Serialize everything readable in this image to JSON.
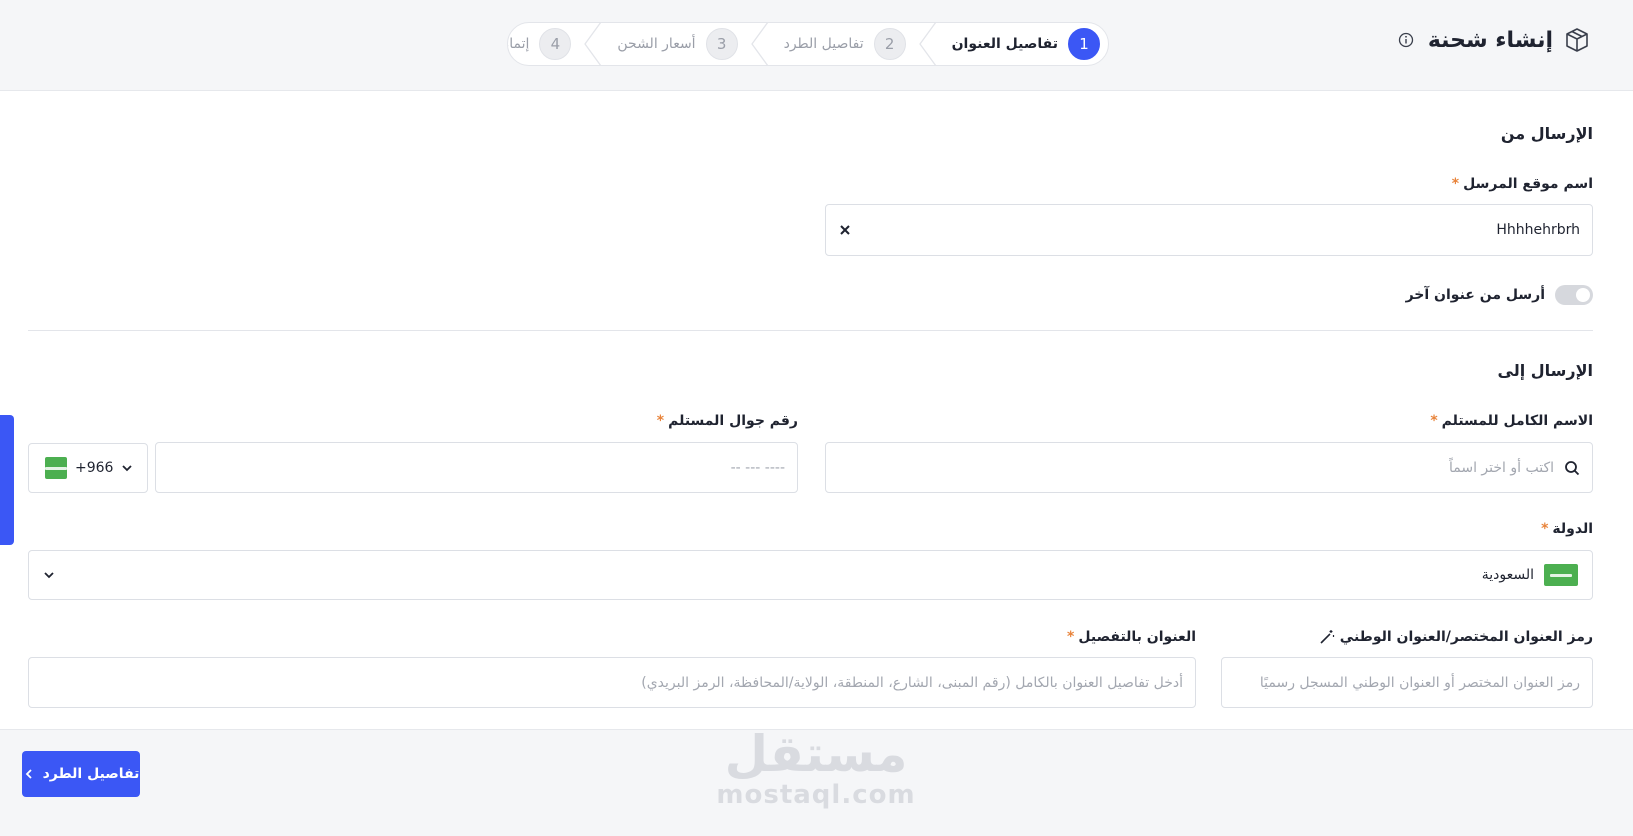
{
  "header": {
    "title": "إنشاء شحنة"
  },
  "stepper": {
    "steps": [
      {
        "number": "1",
        "label": "تفاصيل العنوان"
      },
      {
        "number": "2",
        "label": "تفاصيل الطرد"
      },
      {
        "number": "3",
        "label": "أسعار الشحن"
      },
      {
        "number": "4",
        "label": "إتمام الطلب"
      }
    ]
  },
  "sender": {
    "section_title": "الإرسال من",
    "location_label": "اسم موقع المرسل",
    "location_value": "Hhhhehrbrh",
    "toggle_label": "أرسل من عنوان آخر"
  },
  "recipient": {
    "section_title": "الإرسال إلى",
    "full_name_label": "الاسم الكامل للمستلم",
    "full_name_placeholder": "اكتب  أو اختر اسماً",
    "phone_label": "رقم جوال المستلم",
    "phone_placeholder": "---- --- --",
    "phone_code": "+966",
    "country_label": "الدولة",
    "country_value": "السعودية",
    "short_address_label": "رمز العنوان المختصر/العنوان الوطني",
    "short_address_placeholder": "رمز العنوان المختصر أو العنوان الوطني المسجل رسميًا",
    "detailed_address_label": "العنوان بالتفصيل",
    "detailed_address_placeholder": "أدخل تفاصيل العنوان بالكامل (رقم المبنى، الشارع، المنطقة، الولاية/المحافظة، الرمز البريدي)",
    "required_mark": "*"
  },
  "footer": {
    "next_button_label": "تفاصيل الطرد"
  },
  "watermark": {
    "arabic": "مستقل",
    "latin": "mostaql.com"
  },
  "colors": {
    "primary": "#3b57f5",
    "required": "#e8833a",
    "flag_green": "#4caf50"
  },
  "icons": {
    "title_icon": "package-box-icon",
    "info": "info-icon",
    "clear": "close-icon",
    "search": "search-icon",
    "chevron": "chevron-down-icon",
    "wand": "magic-wand-icon",
    "next": "chevron-left-icon"
  }
}
